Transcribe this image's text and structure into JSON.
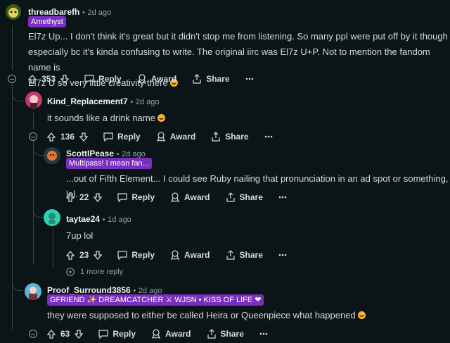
{
  "comments": [
    {
      "username": "threadbarefh",
      "time": "2d ago",
      "flair": "Amethyst",
      "lines": [
        "El7z Up... I don't think it's great but it didn't stop me from listening. So many ppl were put off by it though",
        "especially bc it's kinda confusing to write. The original iirc was El7z U+P. Not to mention the fandom name is",
        "El7z U so very little creativity there"
      ],
      "votes": "353"
    },
    {
      "username": "Kind_Replacement7",
      "time": "2d ago",
      "text": "it sounds like a drink name",
      "votes": "136"
    },
    {
      "username": "ScottIPease",
      "time": "2d ago",
      "flair": "Multipass! I mean fan...",
      "text": "...out of Fifth Element... I could see Ruby nailing that pronunciation in an ad spot or something, lol.",
      "votes": "22"
    },
    {
      "username": "taytae24",
      "time": "1d ago",
      "text": "7up lol",
      "votes": "23"
    },
    {
      "username": "Proof_Surround3856",
      "time": "2d ago",
      "flair": "GFRIEND ✨ DREAMCATCHER ⚔ WJSN • KISS OF LIFE ❤",
      "text": "they were supposed to either be called Heira or Queenpiece what happened",
      "votes": "63"
    }
  ],
  "labels": {
    "reply": "Reply",
    "award": "Award",
    "share": "Share",
    "more_replies": "1 more reply",
    "separator": "•"
  },
  "colors": {
    "background": "#0b1416",
    "flair": "#7b2fbf",
    "text": "#d7dadc",
    "meta": "#8ba2ad"
  }
}
